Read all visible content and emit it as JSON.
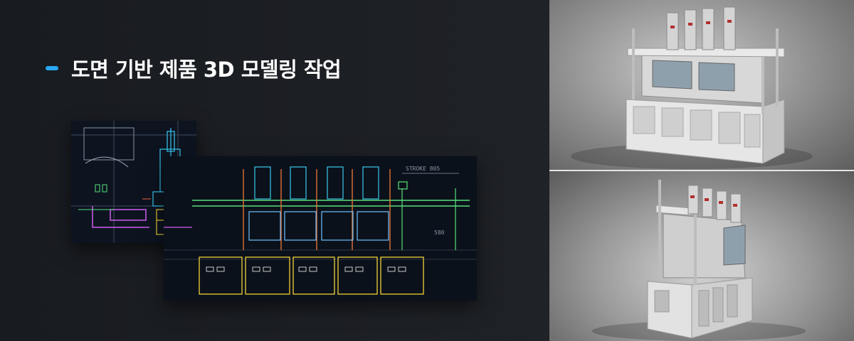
{
  "heading": {
    "bullet_color": "#2aa8f2",
    "title": "도면 기반 제품 3D 모델링 작업"
  },
  "drawing_side_labels": {
    "dim_a": "STROKE 805",
    "dim_b": "580"
  },
  "images": {
    "cad_small": "cad-side-view-icon",
    "cad_large": "cad-front-view-icon",
    "render_top": "machine-render-front-icon",
    "render_bottom": "machine-render-side-icon"
  }
}
